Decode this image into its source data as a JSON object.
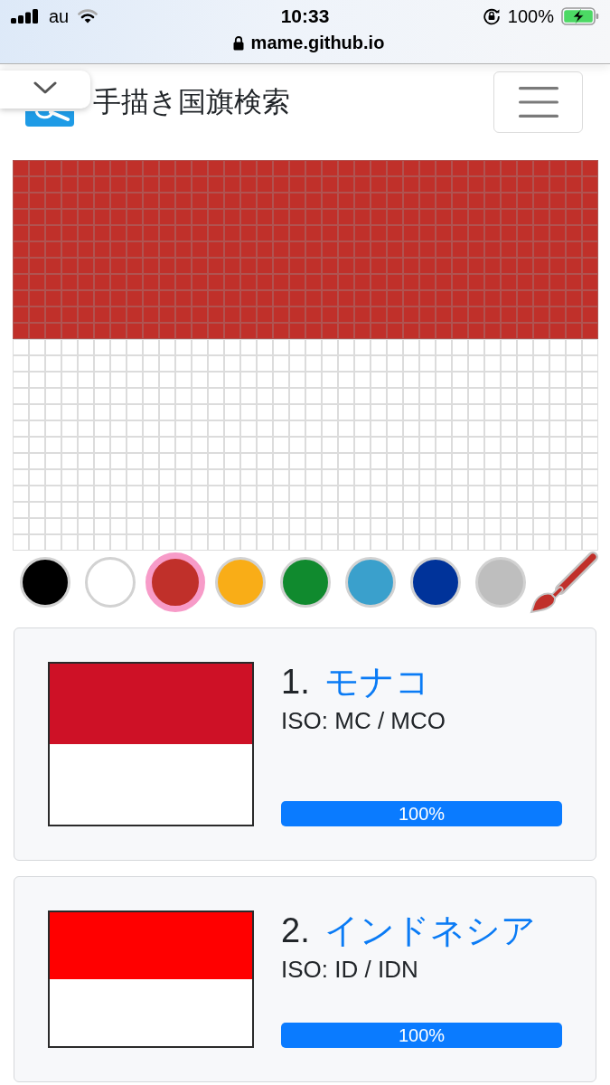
{
  "status_bar": {
    "carrier": "au",
    "time": "10:33",
    "battery": "100%"
  },
  "address_bar": {
    "url": "mame.github.io"
  },
  "header": {
    "title": "手描き国旗検索"
  },
  "palette": [
    {
      "color": "#000000",
      "selected": false
    },
    {
      "color": "#ffffff",
      "selected": false
    },
    {
      "color": "#c0302a",
      "selected": true
    },
    {
      "color": "#f9ad17",
      "selected": false
    },
    {
      "color": "#108a2e",
      "selected": false
    },
    {
      "color": "#3aa0cc",
      "selected": false
    },
    {
      "color": "#00339a",
      "selected": false
    },
    {
      "color": "#bebebe",
      "selected": false
    }
  ],
  "results": [
    {
      "rank": "1.",
      "name": "モナコ",
      "iso": "ISO: MC / MCO",
      "flag": {
        "kind": "tall",
        "stripes": [
          {
            "color": "#ce1126"
          },
          {
            "color": "#ffffff"
          }
        ]
      },
      "match": {
        "level": 1,
        "reading": "100%"
      }
    },
    {
      "rank": "2.",
      "name": "インドネシア",
      "iso": "ISO: ID / IDN",
      "flag": {
        "kind": "wide",
        "stripes": [
          {
            "color": "#ff0000"
          },
          {
            "color": "#ffffff"
          }
        ]
      },
      "match": {
        "level": 1,
        "reading": "100%"
      }
    }
  ]
}
